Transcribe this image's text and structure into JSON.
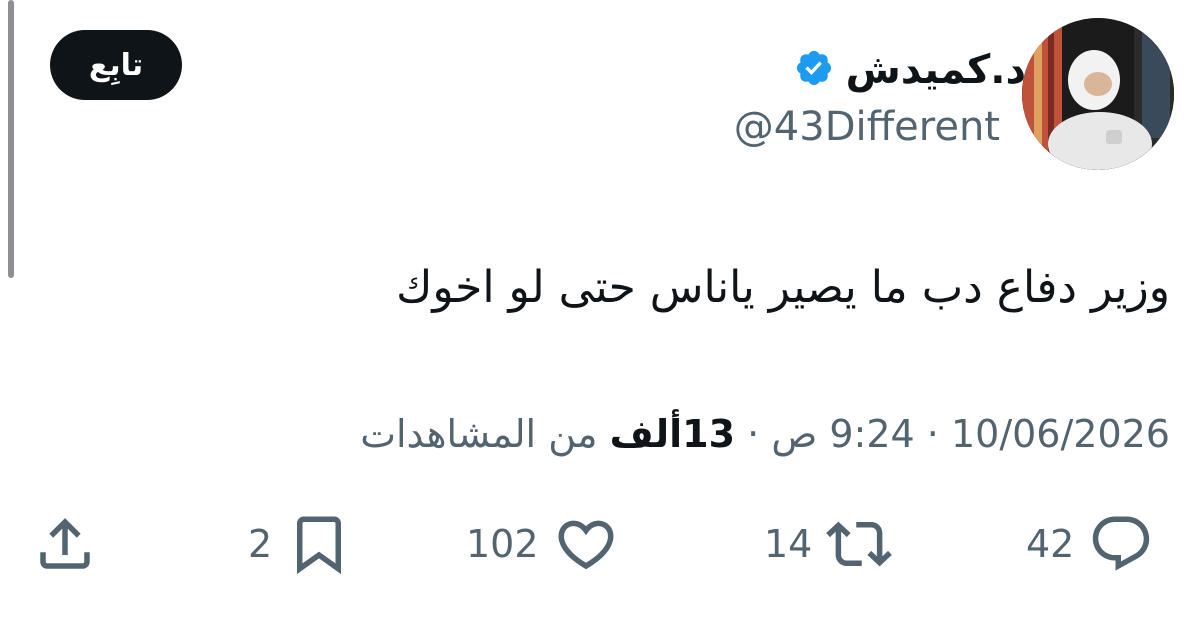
{
  "author": {
    "display_name": "د.كميدش",
    "handle": "@43Different",
    "verified": true
  },
  "follow_button_label": "تابِع",
  "tweet": {
    "text": "وزير دفاع دب ما يصير ياناس حتى لو اخوك"
  },
  "meta": {
    "date": "10/06/2026",
    "separator": "·",
    "time": "9:24 ص",
    "views_count": "13ألف",
    "views_label": "من المشاهدات"
  },
  "actions": {
    "replies": "42",
    "retweets": "14",
    "likes": "102",
    "bookmarks": "2"
  },
  "colors": {
    "text_primary": "#0f1419",
    "text_secondary": "#536471",
    "verified_badge": "#1d9bf0",
    "button_bg": "#0f1419"
  }
}
